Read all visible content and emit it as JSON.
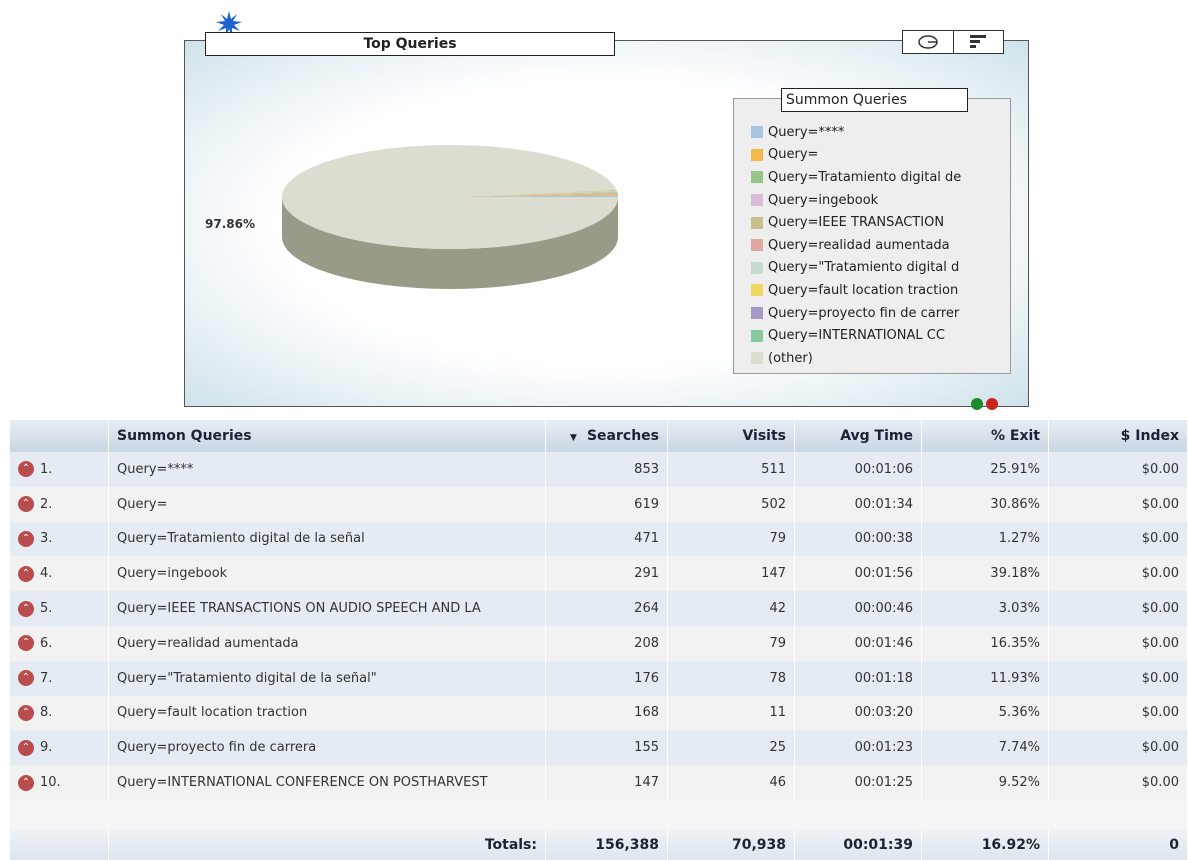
{
  "panel": {
    "title": "Top Queries",
    "percent_label": "97.86%"
  },
  "icons": {
    "burst": "starburst-icon",
    "pie_toggle": "pie-chart-icon",
    "bar_toggle": "bar-chart-icon",
    "rank": "double-chevron-up-icon"
  },
  "legend": {
    "title": "Summon Queries",
    "items": [
      {
        "label": "Query=****",
        "color": "#a8c4e0"
      },
      {
        "label": "Query=",
        "color": "#f2b84a"
      },
      {
        "label": "Query=Tratamiento digital de",
        "color": "#98c48a"
      },
      {
        "label": "Query=ingebook",
        "color": "#d8bcd8"
      },
      {
        "label": "Query=IEEE TRANSACTION",
        "color": "#c8c08a"
      },
      {
        "label": "Query=realidad aumentada",
        "color": "#e0a8a0"
      },
      {
        "label": "Query=\"Tratamiento digital d",
        "color": "#c4dccc"
      },
      {
        "label": "Query=fault location traction",
        "color": "#f0d860"
      },
      {
        "label": "Query=proyecto fin de carrer",
        "color": "#a898c8"
      },
      {
        "label": "Query=INTERNATIONAL CC",
        "color": "#88c8a0"
      },
      {
        "label": "(other)",
        "color": "#dcdcd0"
      }
    ]
  },
  "chart_data": {
    "type": "pie",
    "title": "Top Queries",
    "legend_title": "Summon Queries",
    "legend_position": "right",
    "slices": [
      {
        "label": "Query=****",
        "value": 853
      },
      {
        "label": "Query=",
        "value": 619
      },
      {
        "label": "Query=Tratamiento digital de",
        "value": 471
      },
      {
        "label": "Query=ingebook",
        "value": 291
      },
      {
        "label": "Query=IEEE TRANSACTION",
        "value": 264
      },
      {
        "label": "Query=realidad aumentada",
        "value": 208
      },
      {
        "label": "Query=\"Tratamiento digital d",
        "value": 176
      },
      {
        "label": "Query=fault location traction",
        "value": 168
      },
      {
        "label": "Query=proyecto fin de carrer",
        "value": 155
      },
      {
        "label": "Query=INTERNATIONAL CC",
        "value": 147
      },
      {
        "label": "(other)",
        "value": 153036
      }
    ],
    "annotations": [
      "97.86%"
    ]
  },
  "table": {
    "columns": [
      "",
      "Summon Queries",
      "Searches",
      "Visits",
      "Avg Time",
      "% Exit",
      "$ Index"
    ],
    "rows": [
      {
        "rank": "1.",
        "query": "Query=****",
        "searches": "853",
        "visits": "511",
        "avg_time": "00:01:06",
        "exit": "25.91%",
        "index": "$0.00"
      },
      {
        "rank": "2.",
        "query": "Query=",
        "searches": "619",
        "visits": "502",
        "avg_time": "00:01:34",
        "exit": "30.86%",
        "index": "$0.00"
      },
      {
        "rank": "3.",
        "query": "Query=Tratamiento digital de la señal",
        "searches": "471",
        "visits": "79",
        "avg_time": "00:00:38",
        "exit": "1.27%",
        "index": "$0.00"
      },
      {
        "rank": "4.",
        "query": "Query=ingebook",
        "searches": "291",
        "visits": "147",
        "avg_time": "00:01:56",
        "exit": "39.18%",
        "index": "$0.00"
      },
      {
        "rank": "5.",
        "query": "Query=IEEE TRANSACTIONS ON AUDIO SPEECH AND LA",
        "searches": "264",
        "visits": "42",
        "avg_time": "00:00:46",
        "exit": "3.03%",
        "index": "$0.00"
      },
      {
        "rank": "6.",
        "query": "Query=realidad aumentada",
        "searches": "208",
        "visits": "79",
        "avg_time": "00:01:46",
        "exit": "16.35%",
        "index": "$0.00"
      },
      {
        "rank": "7.",
        "query": "Query=\"Tratamiento digital de la señal\"",
        "searches": "176",
        "visits": "78",
        "avg_time": "00:01:18",
        "exit": "11.93%",
        "index": "$0.00"
      },
      {
        "rank": "8.",
        "query": "Query=fault location traction",
        "searches": "168",
        "visits": "11",
        "avg_time": "00:03:20",
        "exit": "5.36%",
        "index": "$0.00"
      },
      {
        "rank": "9.",
        "query": "Query=proyecto fin de carrera",
        "searches": "155",
        "visits": "25",
        "avg_time": "00:01:23",
        "exit": "7.74%",
        "index": "$0.00"
      },
      {
        "rank": "10.",
        "query": "Query=INTERNATIONAL CONFERENCE ON POSTHARVEST",
        "searches": "147",
        "visits": "46",
        "avg_time": "00:01:25",
        "exit": "9.52%",
        "index": "$0.00"
      }
    ],
    "totals": {
      "label": "Totals:",
      "searches": "156,388",
      "visits": "70,938",
      "avg_time": "00:01:39",
      "exit": "16.92%",
      "index": "0"
    }
  }
}
